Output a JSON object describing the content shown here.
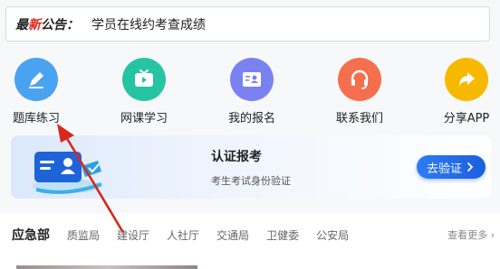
{
  "notice": {
    "tag_prefix": "最",
    "tag_red": "新",
    "tag_suffix": "公告：",
    "text": "学员在线约考查成绩"
  },
  "quick_items": [
    {
      "label": "题库练习",
      "icon": "pencil-icon",
      "color": "#4aa3f0"
    },
    {
      "label": "网课学习",
      "icon": "tv-icon",
      "color": "#26c4a2"
    },
    {
      "label": "我的报名",
      "icon": "id-card-icon",
      "color": "#7b82f0"
    },
    {
      "label": "联系我们",
      "icon": "headset-icon",
      "color": "#f56f4f"
    },
    {
      "label": "分享APP",
      "icon": "share-icon",
      "color": "#f7b900"
    }
  ],
  "card": {
    "title": "认证报考",
    "subtitle": "考生考试身份验证",
    "button": "去验证",
    "accent": "#1b5fe0"
  },
  "tabs": [
    {
      "label": "应急部",
      "active": true
    },
    {
      "label": "质监局",
      "active": false
    },
    {
      "label": "建设厅",
      "active": false
    },
    {
      "label": "人社厅",
      "active": false
    },
    {
      "label": "交通局",
      "active": false
    },
    {
      "label": "卫健委",
      "active": false
    },
    {
      "label": "公安局",
      "active": false
    }
  ],
  "more_label": "查看更多",
  "annotation_color": "#d9281e"
}
